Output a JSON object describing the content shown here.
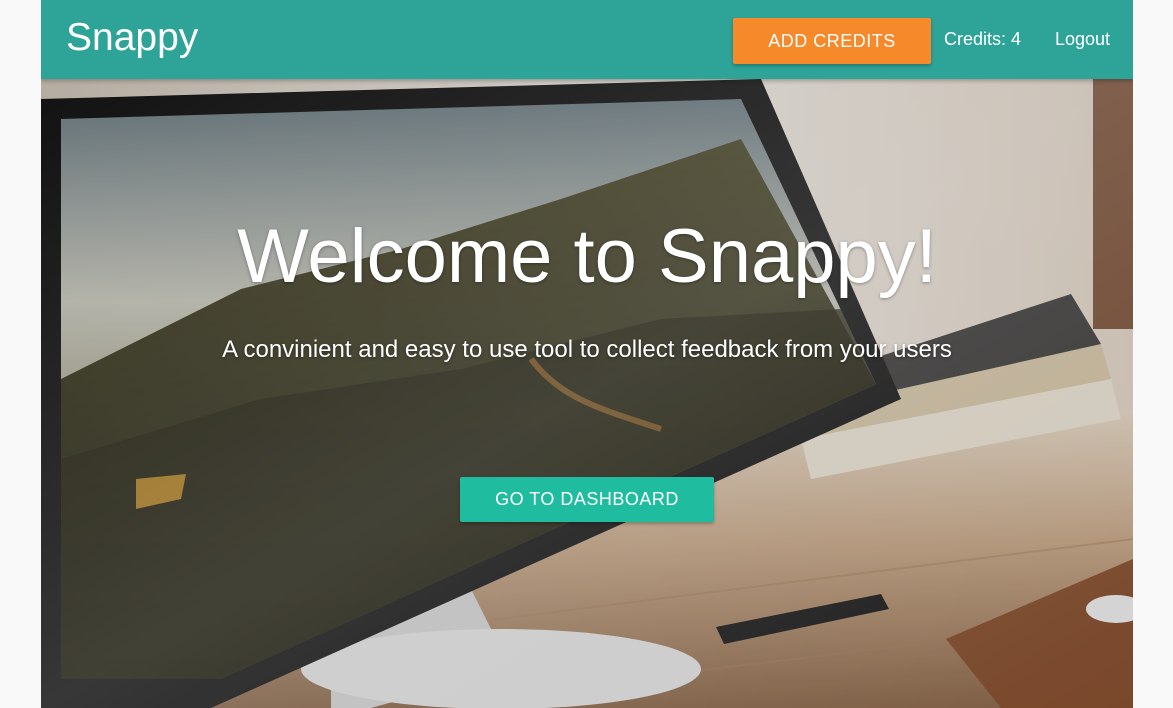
{
  "navbar": {
    "brand": "Snappy",
    "add_credits_label": "ADD CREDITS",
    "credits_label": "Credits: 4",
    "logout_label": "Logout",
    "background_color": "#2ea398",
    "add_credits_color": "#f6892a"
  },
  "hero": {
    "title": "Welcome to Snappy!",
    "subtitle": "A convinient and easy to use tool to collect feedback from your users",
    "cta_label": "GO TO DASHBOARD",
    "cta_color": "#1fbc9f"
  }
}
